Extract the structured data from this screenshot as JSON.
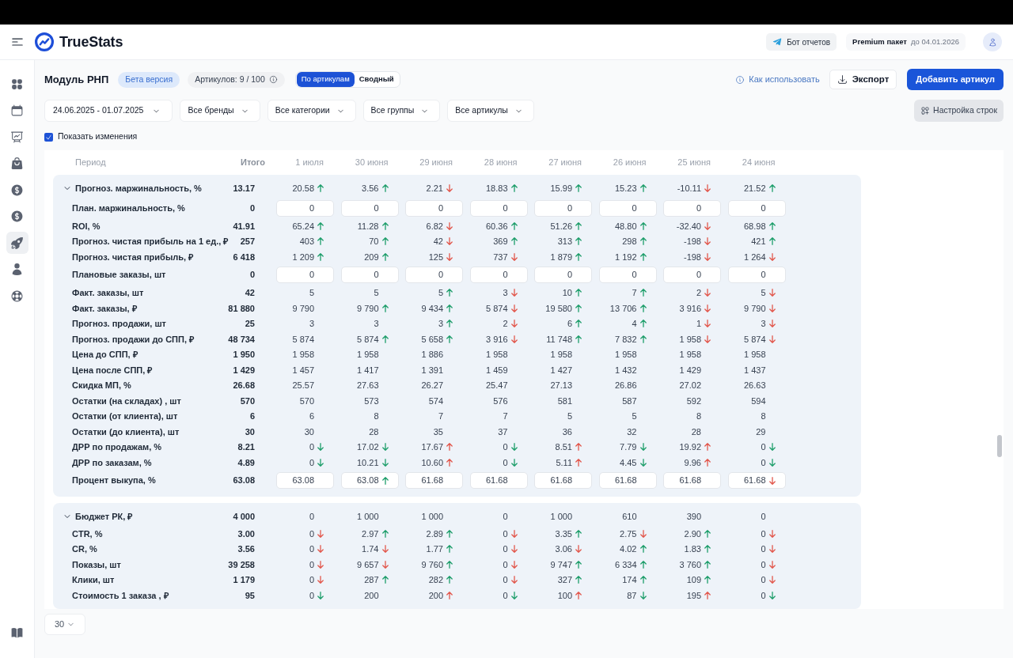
{
  "app_header": {
    "brand": "TrueStats",
    "report_bot_button": "Бот отчетов",
    "plan": {
      "name": "Premium пакет",
      "expires": "до 04.01.2026"
    }
  },
  "sidebar": {
    "items": [
      {
        "selected": false
      },
      {
        "selected": false
      },
      {
        "selected": false
      },
      {
        "selected": false
      },
      {
        "selected": false
      },
      {
        "selected": false
      },
      {
        "selected": true
      },
      {
        "selected": false
      },
      {
        "selected": false
      }
    ]
  },
  "toolbar": {
    "title": "Модуль РНП",
    "badge": "Бета версия",
    "articles_count": "Артикулов: 9 / 100",
    "view_tabs": [
      {
        "label": "По артикулам",
        "selected": true
      },
      {
        "label": "Сводный",
        "selected": false
      }
    ],
    "help_link": "Как использовать",
    "export_button": "Экспорт",
    "add_button": "Добавить артикул"
  },
  "filters": {
    "dropdowns": [
      "24.06.2025 - 01.07.2025",
      "Все бренды",
      "Все категории",
      "Все группы",
      "Все артикулы"
    ],
    "rows_settings_button": "Настройка строк"
  },
  "show_changes": {
    "label": "Показать изменения",
    "checked": true
  },
  "table": {
    "columns": {
      "period": "Период",
      "total": "Итого",
      "dates": [
        "1 июля",
        "30 июня",
        "29 июня",
        "28 июня",
        "27 июня",
        "26 июня",
        "25 июня",
        "24 июня"
      ]
    },
    "groups": [
      {
        "label": "Прогноз. маржинальность, %",
        "total": "13.17",
        "expanded": true,
        "cells": [
          {
            "value": "20.58",
            "up": true,
            "good": true
          },
          {
            "value": "3.56",
            "up": true,
            "good": true
          },
          {
            "value": "2.21",
            "down": true,
            "good": false
          },
          {
            "value": "18.83",
            "up": true,
            "good": true
          },
          {
            "value": "15.99",
            "up": true,
            "good": true
          },
          {
            "value": "15.23",
            "up": true,
            "good": true
          },
          {
            "value": "-10.11",
            "down": true,
            "good": false
          },
          {
            "value": "21.52",
            "up": true,
            "good": true
          }
        ],
        "rows": [
          {
            "label": "План. маржинальность, %",
            "total": "0",
            "kind": "input",
            "cells": [
              {
                "value": "0"
              },
              {
                "value": "0"
              },
              {
                "value": "0"
              },
              {
                "value": "0"
              },
              {
                "value": "0"
              },
              {
                "value": "0"
              },
              {
                "value": "0"
              },
              {
                "value": "0"
              }
            ]
          },
          {
            "label": "ROI, %",
            "total": "41.91",
            "kind": "value",
            "cells": [
              {
                "value": "65.24",
                "up": true,
                "good": true
              },
              {
                "value": "11.28",
                "up": true,
                "good": true
              },
              {
                "value": "6.82",
                "down": true,
                "good": false
              },
              {
                "value": "60.36",
                "up": true,
                "good": true
              },
              {
                "value": "51.26",
                "up": true,
                "good": true
              },
              {
                "value": "48.80",
                "up": true,
                "good": true
              },
              {
                "value": "-32.40",
                "down": true,
                "good": false
              },
              {
                "value": "68.98",
                "up": true,
                "good": true
              }
            ]
          },
          {
            "label": "Прогноз. чистая прибыль на 1 ед., ₽",
            "total": "257",
            "kind": "value",
            "cells": [
              {
                "value": "403",
                "up": true,
                "good": true
              },
              {
                "value": "70",
                "up": true,
                "good": true
              },
              {
                "value": "42",
                "down": true,
                "good": false
              },
              {
                "value": "369",
                "up": true,
                "good": true
              },
              {
                "value": "313",
                "up": true,
                "good": true
              },
              {
                "value": "298",
                "up": true,
                "good": true
              },
              {
                "value": "-198",
                "down": true,
                "good": false
              },
              {
                "value": "421",
                "up": true,
                "good": true
              }
            ]
          },
          {
            "label": "Прогноз. чистая прибыль, ₽",
            "total": "6 418",
            "kind": "value",
            "cells": [
              {
                "value": "1 209",
                "up": true,
                "good": true
              },
              {
                "value": "209",
                "up": true,
                "good": true
              },
              {
                "value": "125",
                "down": true,
                "good": false
              },
              {
                "value": "737",
                "down": true,
                "good": false
              },
              {
                "value": "1 879",
                "up": true,
                "good": true
              },
              {
                "value": "1 192",
                "up": true,
                "good": true
              },
              {
                "value": "-198",
                "down": true,
                "good": false
              },
              {
                "value": "1 264",
                "down": true,
                "good": false
              }
            ]
          },
          {
            "label": "Плановые заказы, шт",
            "total": "0",
            "kind": "input",
            "cells": [
              {
                "value": "0"
              },
              {
                "value": "0"
              },
              {
                "value": "0"
              },
              {
                "value": "0"
              },
              {
                "value": "0"
              },
              {
                "value": "0"
              },
              {
                "value": "0"
              },
              {
                "value": "0"
              }
            ]
          },
          {
            "label": "Факт. заказы, шт",
            "total": "42",
            "kind": "value",
            "cells": [
              {
                "value": "5"
              },
              {
                "value": "5"
              },
              {
                "value": "5",
                "up": true,
                "good": true
              },
              {
                "value": "3",
                "down": true,
                "good": false
              },
              {
                "value": "10",
                "up": true,
                "good": true
              },
              {
                "value": "7",
                "up": true,
                "good": true
              },
              {
                "value": "2",
                "down": true,
                "good": false
              },
              {
                "value": "5",
                "down": true,
                "good": false
              }
            ]
          },
          {
            "label": "Факт. заказы, ₽",
            "total": "81 880",
            "kind": "value",
            "cells": [
              {
                "value": "9 790"
              },
              {
                "value": "9 790",
                "up": true,
                "good": true
              },
              {
                "value": "9 434",
                "up": true,
                "good": true
              },
              {
                "value": "5 874",
                "down": true,
                "good": false
              },
              {
                "value": "19 580",
                "up": true,
                "good": true
              },
              {
                "value": "13 706",
                "up": true,
                "good": true
              },
              {
                "value": "3 916",
                "down": true,
                "good": false
              },
              {
                "value": "9 790",
                "down": true,
                "good": false
              }
            ]
          },
          {
            "label": "Прогноз. продажи, шт",
            "total": "25",
            "kind": "value",
            "cells": [
              {
                "value": "3"
              },
              {
                "value": "3"
              },
              {
                "value": "3",
                "up": true,
                "good": true
              },
              {
                "value": "2",
                "down": true,
                "good": false
              },
              {
                "value": "6",
                "up": true,
                "good": true
              },
              {
                "value": "4",
                "up": true,
                "good": true
              },
              {
                "value": "1",
                "down": true,
                "good": false
              },
              {
                "value": "3",
                "down": true,
                "good": false
              }
            ]
          },
          {
            "label": "Прогноз. продажи до СПП, ₽",
            "total": "48 734",
            "kind": "value",
            "cells": [
              {
                "value": "5 874"
              },
              {
                "value": "5 874",
                "up": true,
                "good": true
              },
              {
                "value": "5 658",
                "up": true,
                "good": true
              },
              {
                "value": "3 916",
                "down": true,
                "good": false
              },
              {
                "value": "11 748",
                "up": true,
                "good": true
              },
              {
                "value": "7 832",
                "up": true,
                "good": true
              },
              {
                "value": "1 958",
                "down": true,
                "good": false
              },
              {
                "value": "5 874",
                "down": true,
                "good": false
              }
            ]
          },
          {
            "label": "Цена до СПП, ₽",
            "total": "1 950",
            "kind": "value",
            "cells": [
              {
                "value": "1 958"
              },
              {
                "value": "1 958"
              },
              {
                "value": "1 886"
              },
              {
                "value": "1 958"
              },
              {
                "value": "1 958"
              },
              {
                "value": "1 958"
              },
              {
                "value": "1 958"
              },
              {
                "value": "1 958"
              }
            ]
          },
          {
            "label": "Цена после СПП, ₽",
            "total": "1 429",
            "kind": "value",
            "cells": [
              {
                "value": "1 457"
              },
              {
                "value": "1 417"
              },
              {
                "value": "1 391"
              },
              {
                "value": "1 459"
              },
              {
                "value": "1 427"
              },
              {
                "value": "1 432"
              },
              {
                "value": "1 429"
              },
              {
                "value": "1 437"
              }
            ]
          },
          {
            "label": "Скидка МП, %",
            "total": "26.68",
            "kind": "value",
            "cells": [
              {
                "value": "25.57"
              },
              {
                "value": "27.63"
              },
              {
                "value": "26.27"
              },
              {
                "value": "25.47"
              },
              {
                "value": "27.13"
              },
              {
                "value": "26.86"
              },
              {
                "value": "27.02"
              },
              {
                "value": "26.63"
              }
            ]
          },
          {
            "label": "Остатки (на складах) , шт",
            "total": "570",
            "kind": "value",
            "cells": [
              {
                "value": "570"
              },
              {
                "value": "573"
              },
              {
                "value": "574"
              },
              {
                "value": "576"
              },
              {
                "value": "581"
              },
              {
                "value": "587"
              },
              {
                "value": "592"
              },
              {
                "value": "594"
              }
            ]
          },
          {
            "label": "Остатки (от клиента), шт",
            "total": "6",
            "kind": "value",
            "cells": [
              {
                "value": "6"
              },
              {
                "value": "8"
              },
              {
                "value": "7"
              },
              {
                "value": "7"
              },
              {
                "value": "5"
              },
              {
                "value": "5"
              },
              {
                "value": "8"
              },
              {
                "value": "8"
              }
            ]
          },
          {
            "label": "Остатки (до клиента), шт",
            "total": "30",
            "kind": "value",
            "cells": [
              {
                "value": "30"
              },
              {
                "value": "28"
              },
              {
                "value": "35"
              },
              {
                "value": "37"
              },
              {
                "value": "36"
              },
              {
                "value": "32"
              },
              {
                "value": "28"
              },
              {
                "value": "29"
              }
            ]
          },
          {
            "label": "ДРР по продажам, %",
            "total": "8.21",
            "kind": "value",
            "cells": [
              {
                "value": "0",
                "down": true,
                "good": true
              },
              {
                "value": "17.02",
                "down": true,
                "good": true
              },
              {
                "value": "17.67",
                "up": true,
                "good": false
              },
              {
                "value": "0",
                "down": true,
                "good": true
              },
              {
                "value": "8.51",
                "up": true,
                "good": false
              },
              {
                "value": "7.79",
                "down": true,
                "good": true
              },
              {
                "value": "19.92",
                "up": true,
                "good": false
              },
              {
                "value": "0",
                "down": true,
                "good": true
              }
            ]
          },
          {
            "label": "ДРР по заказам, %",
            "total": "4.89",
            "kind": "value",
            "cells": [
              {
                "value": "0",
                "down": true,
                "good": true
              },
              {
                "value": "10.21",
                "down": true,
                "good": true
              },
              {
                "value": "10.60",
                "up": true,
                "good": false
              },
              {
                "value": "0",
                "down": true,
                "good": true
              },
              {
                "value": "5.11",
                "up": true,
                "good": false
              },
              {
                "value": "4.45",
                "down": true,
                "good": true
              },
              {
                "value": "9.96",
                "up": true,
                "good": false
              },
              {
                "value": "0",
                "down": true,
                "good": true
              }
            ]
          },
          {
            "label": "Процент выкупа, %",
            "total": "63.08",
            "kind": "input",
            "cells": [
              {
                "value": "63.08"
              },
              {
                "value": "63.08",
                "up": true,
                "good": true
              },
              {
                "value": "61.68"
              },
              {
                "value": "61.68"
              },
              {
                "value": "61.68"
              },
              {
                "value": "61.68"
              },
              {
                "value": "61.68"
              },
              {
                "value": "61.68",
                "down": true,
                "good": false
              }
            ]
          }
        ]
      },
      {
        "label": "Бюджет РК, ₽",
        "total": "4 000",
        "expanded": true,
        "cells": [
          {
            "value": "0"
          },
          {
            "value": "1 000"
          },
          {
            "value": "1 000"
          },
          {
            "value": "0"
          },
          {
            "value": "1 000"
          },
          {
            "value": "610"
          },
          {
            "value": "390"
          },
          {
            "value": "0"
          }
        ],
        "rows": [
          {
            "label": "CTR, %",
            "total": "3.00",
            "kind": "value",
            "cells": [
              {
                "value": "0",
                "down": true,
                "good": false
              },
              {
                "value": "2.97",
                "up": true,
                "good": true
              },
              {
                "value": "2.89",
                "up": true,
                "good": true
              },
              {
                "value": "0",
                "down": true,
                "good": false
              },
              {
                "value": "3.35",
                "up": true,
                "good": true
              },
              {
                "value": "2.75",
                "down": true,
                "good": false
              },
              {
                "value": "2.90",
                "up": true,
                "good": true
              },
              {
                "value": "0",
                "down": true,
                "good": false
              }
            ]
          },
          {
            "label": "CR, %",
            "total": "3.56",
            "kind": "value",
            "cells": [
              {
                "value": "0",
                "down": true,
                "good": false
              },
              {
                "value": "1.74",
                "down": true,
                "good": false
              },
              {
                "value": "1.77",
                "up": true,
                "good": true
              },
              {
                "value": "0",
                "down": true,
                "good": false
              },
              {
                "value": "3.06",
                "down": true,
                "good": false
              },
              {
                "value": "4.02",
                "up": true,
                "good": true
              },
              {
                "value": "1.83",
                "up": true,
                "good": true
              },
              {
                "value": "0",
                "down": true,
                "good": false
              }
            ]
          },
          {
            "label": "Показы, шт",
            "total": "39 258",
            "kind": "value",
            "cells": [
              {
                "value": "0",
                "down": true,
                "good": false
              },
              {
                "value": "9 657",
                "down": true,
                "good": false
              },
              {
                "value": "9 760",
                "up": true,
                "good": true
              },
              {
                "value": "0",
                "down": true,
                "good": false
              },
              {
                "value": "9 747",
                "up": true,
                "good": true
              },
              {
                "value": "6 334",
                "up": true,
                "good": true
              },
              {
                "value": "3 760",
                "up": true,
                "good": true
              },
              {
                "value": "0",
                "down": true,
                "good": false
              }
            ]
          },
          {
            "label": "Клики, шт",
            "total": "1 179",
            "kind": "value",
            "cells": [
              {
                "value": "0",
                "down": true,
                "good": false
              },
              {
                "value": "287",
                "up": true,
                "good": true
              },
              {
                "value": "282",
                "up": true,
                "good": true
              },
              {
                "value": "0",
                "down": true,
                "good": false
              },
              {
                "value": "327",
                "up": true,
                "good": true
              },
              {
                "value": "174",
                "up": true,
                "good": true
              },
              {
                "value": "109",
                "up": true,
                "good": true
              },
              {
                "value": "0",
                "down": true,
                "good": false
              }
            ]
          },
          {
            "label": "Стоимость 1 заказа , ₽",
            "total": "95",
            "kind": "value",
            "cells": [
              {
                "value": "0",
                "down": true,
                "good": true
              },
              {
                "value": "200"
              },
              {
                "value": "200",
                "up": true,
                "good": false
              },
              {
                "value": "0",
                "down": true,
                "good": true
              },
              {
                "value": "100",
                "up": true,
                "good": false
              },
              {
                "value": "87",
                "down": true,
                "good": true
              },
              {
                "value": "195",
                "up": true,
                "good": false
              },
              {
                "value": "0",
                "down": true,
                "good": true
              }
            ]
          }
        ]
      }
    ]
  },
  "pagination": {
    "page_size": "30"
  }
}
